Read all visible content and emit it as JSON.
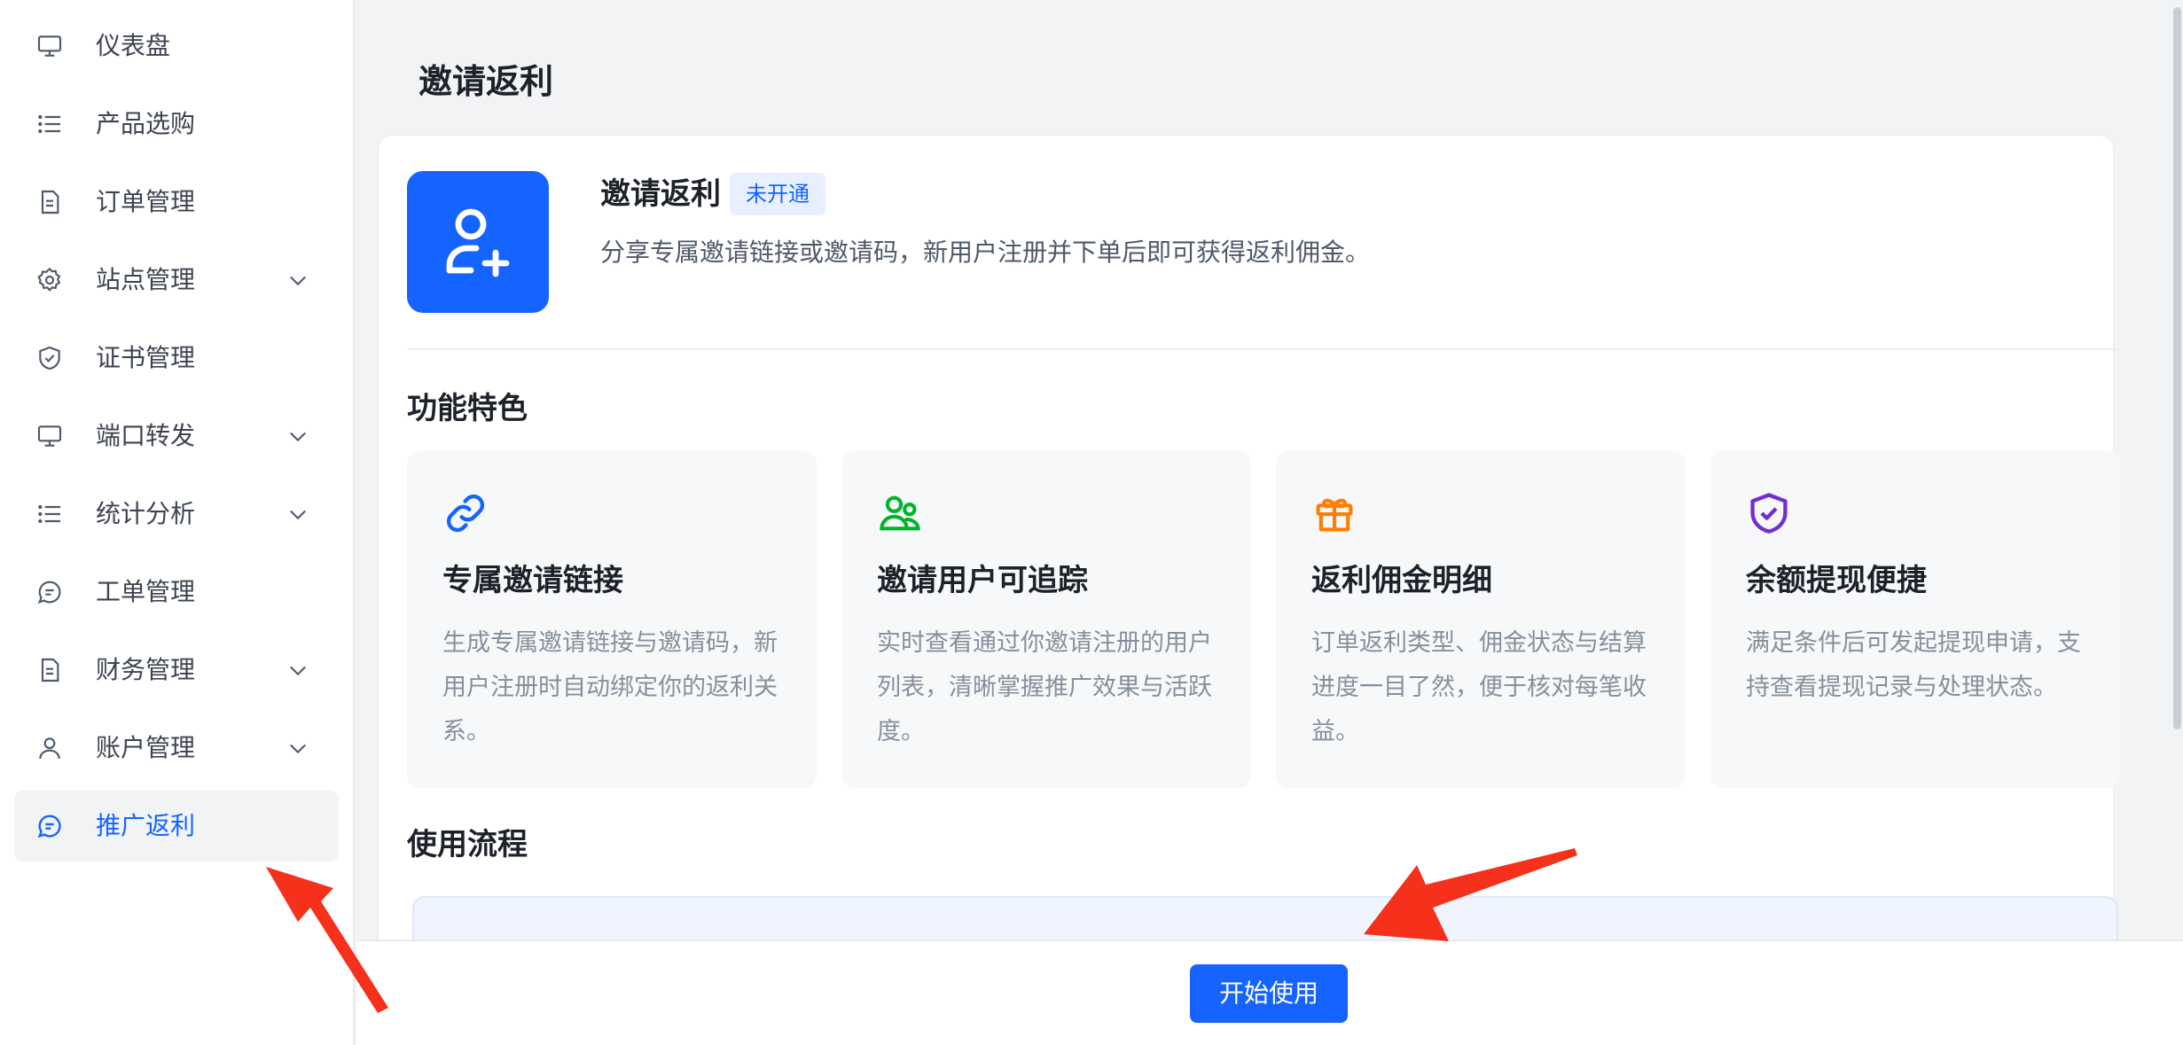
{
  "sidebar": {
    "items": [
      {
        "label": "仪表盘",
        "icon": "monitor-icon",
        "expandable": false,
        "active": false
      },
      {
        "label": "产品选购",
        "icon": "list-icon",
        "expandable": false,
        "active": false
      },
      {
        "label": "订单管理",
        "icon": "document-icon",
        "expandable": false,
        "active": false
      },
      {
        "label": "站点管理",
        "icon": "gear-icon",
        "expandable": true,
        "active": false
      },
      {
        "label": "证书管理",
        "icon": "shield-check-icon",
        "expandable": false,
        "active": false
      },
      {
        "label": "端口转发",
        "icon": "monitor-icon",
        "expandable": true,
        "active": false
      },
      {
        "label": "统计分析",
        "icon": "list-icon",
        "expandable": true,
        "active": false
      },
      {
        "label": "工单管理",
        "icon": "chat-icon",
        "expandable": false,
        "active": false
      },
      {
        "label": "财务管理",
        "icon": "document-icon",
        "expandable": true,
        "active": false
      },
      {
        "label": "账户管理",
        "icon": "user-icon",
        "expandable": true,
        "active": false
      },
      {
        "label": "推广返利",
        "icon": "chat-icon",
        "expandable": false,
        "active": true
      }
    ]
  },
  "page": {
    "title": "邀请返利"
  },
  "hero": {
    "icon": "user-plus-icon",
    "title": "邀请返利",
    "badge": "未开通",
    "description": "分享专属邀请链接或邀请码，新用户注册并下单后即可获得返利佣金。"
  },
  "features_section": {
    "title": "功能特色",
    "items": [
      {
        "icon": "link-icon",
        "icon_color": "#1664ff",
        "title": "专属邀请链接",
        "description": "生成专属邀请链接与邀请码，新用户注册时自动绑定你的返利关系。"
      },
      {
        "icon": "users-icon",
        "icon_color": "#00b42a",
        "title": "邀请用户可追踪",
        "description": "实时查看通过你邀请注册的用户列表，清晰掌握推广效果与活跃度。"
      },
      {
        "icon": "gift-icon",
        "icon_color": "#ff7d00",
        "title": "返利佣金明细",
        "description": "订单返利类型、佣金状态与结算进度一目了然，便于核对每笔收益。"
      },
      {
        "icon": "shield-check-icon",
        "icon_color": "#722ed1",
        "title": "余额提现便捷",
        "description": "满足条件后可发起提现申请，支持查看提现记录与处理状态。"
      }
    ]
  },
  "flow_section": {
    "title": "使用流程"
  },
  "footer": {
    "start_label": "开始使用"
  },
  "colors": {
    "primary": "#1664ff",
    "annotation_arrow": "#f5301b"
  }
}
